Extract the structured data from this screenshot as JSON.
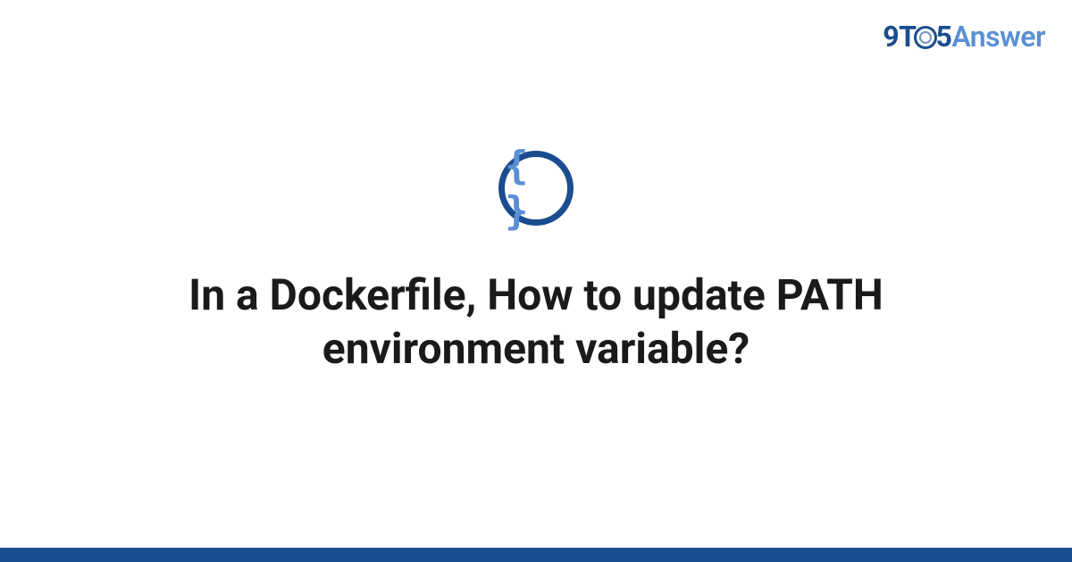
{
  "logo": {
    "part1": "9T",
    "part2": "5",
    "answer": "Answer"
  },
  "icon": {
    "name": "code-braces-icon",
    "glyph": "{ }"
  },
  "title": "In a Dockerfile, How to update PATH environment variable?",
  "colors": {
    "primary": "#1a4d8f",
    "accent": "#5a8fd4",
    "text": "#1a1a1a"
  }
}
